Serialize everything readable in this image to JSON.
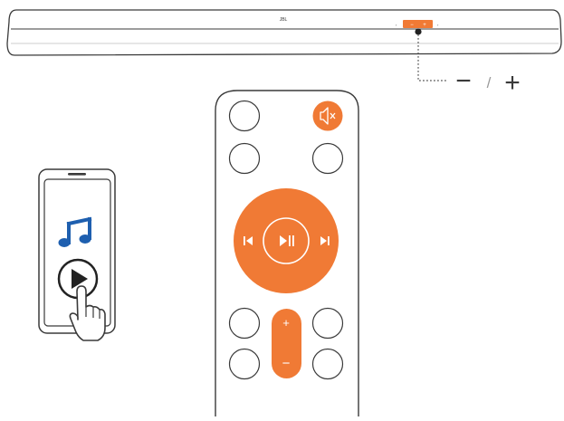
{
  "colors": {
    "accent": "#F07A35",
    "outline": "#3A3A3A",
    "note": "#1E5FAF",
    "white": "#FFFFFF",
    "dotted_line": "#555555"
  },
  "soundbar": {
    "logo": "JBL",
    "minus_label": "−",
    "slash_label": "/",
    "plus_label": "+"
  },
  "remote": {
    "icons": [
      "mute-icon",
      "previous-icon",
      "play-pause-icon",
      "next-icon"
    ],
    "vol_plus_label": "+",
    "vol_minus_label": "−"
  },
  "phone": {
    "icons": [
      "music-note-icon",
      "play-icon",
      "hand-pointer-icon"
    ]
  }
}
